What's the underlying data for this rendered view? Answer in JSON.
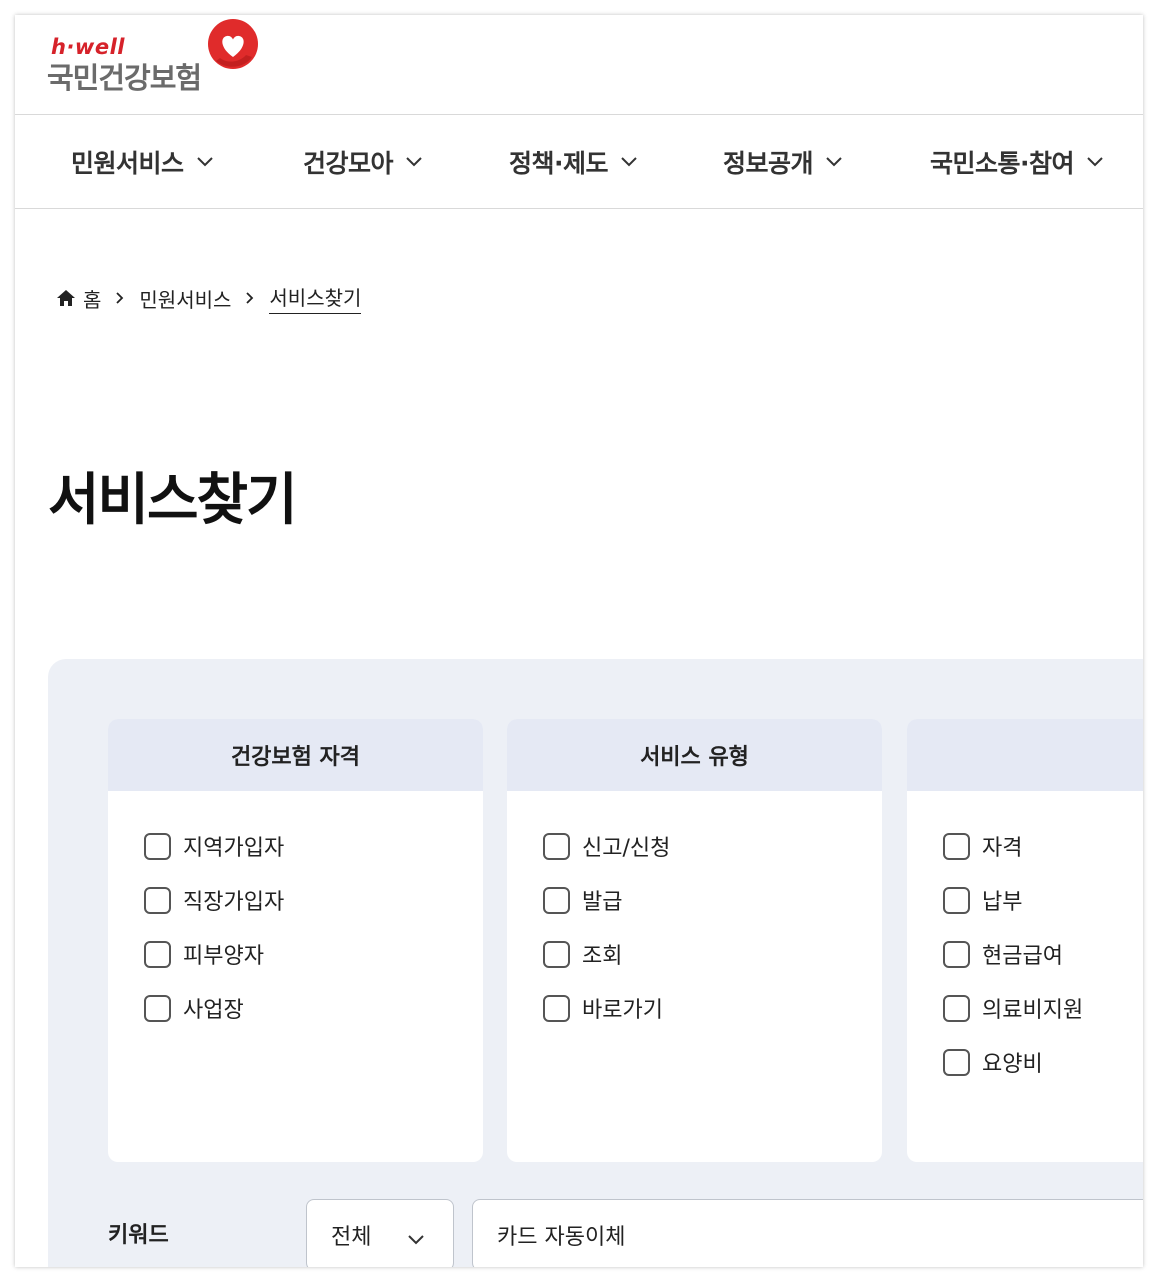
{
  "logo": {
    "tagline": "h·well",
    "name": "국민건강보험",
    "brand_color": "#d6222a"
  },
  "nav": {
    "items": [
      {
        "label": "민원서비스"
      },
      {
        "label": "건강모아"
      },
      {
        "label": "정책·제도"
      },
      {
        "label": "정보공개"
      },
      {
        "label": "국민소통·참여"
      }
    ]
  },
  "breadcrumb": {
    "home": "홈",
    "level1": "민원서비스",
    "current": "서비스찾기"
  },
  "page": {
    "title": "서비스찾기"
  },
  "filters": {
    "cards": [
      {
        "title": "건강보험 자격",
        "options": [
          "지역가입자",
          "직장가입자",
          "피부양자",
          "사업장"
        ]
      },
      {
        "title": "서비스 유형",
        "options": [
          "신고/신청",
          "발급",
          "조회",
          "바로가기"
        ]
      },
      {
        "title": "",
        "options": [
          "자격",
          "납부",
          "현금급여",
          "의료비지원",
          "요양비"
        ]
      }
    ],
    "keyword": {
      "label": "키워드",
      "select_value": "전체",
      "input_value": "카드 자동이체"
    }
  }
}
